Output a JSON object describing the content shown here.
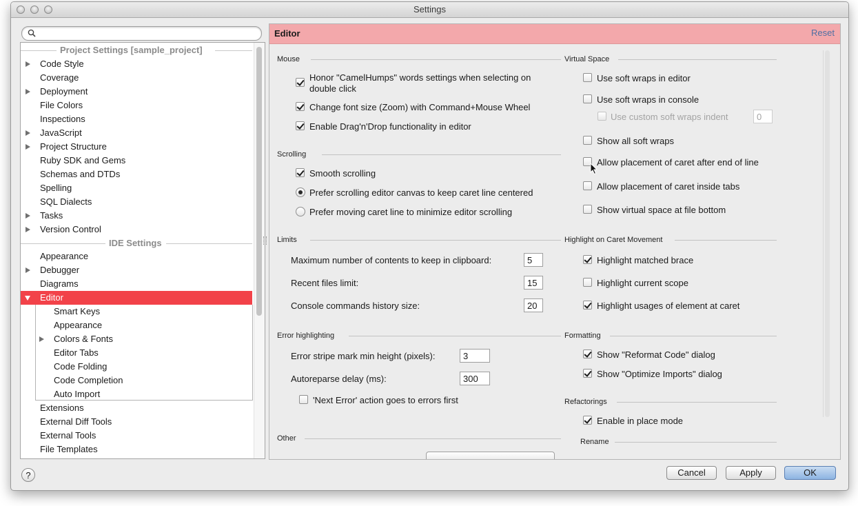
{
  "window": {
    "title": "Settings"
  },
  "search": {
    "placeholder": "",
    "value": ""
  },
  "tree": {
    "project_group": "Project Settings [sample_project]",
    "project_items": [
      "Code Style",
      "Coverage",
      "Deployment",
      "File Colors",
      "Inspections",
      "JavaScript",
      "Project Structure",
      "Ruby SDK and Gems",
      "Schemas and DTDs",
      "Spelling",
      "SQL Dialects",
      "Tasks",
      "Version Control"
    ],
    "ide_group": "IDE Settings",
    "ide_items": [
      "Appearance",
      "Debugger",
      "Diagrams",
      "Editor"
    ],
    "editor_children": [
      "Smart Keys",
      "Appearance",
      "Colors & Fonts",
      "Editor Tabs",
      "Code Folding",
      "Code Completion",
      "Auto Import"
    ],
    "after_items": [
      "Extensions",
      "External Diff Tools",
      "External Tools",
      "File Templates"
    ],
    "selected": "Editor"
  },
  "editor": {
    "title": "Editor",
    "reset_label": "Reset",
    "mouse": {
      "title": "Mouse",
      "camelhumps_line1": "Honor \"CamelHumps\" words settings when selecting on",
      "camelhumps_line2": "double click",
      "change_font": "Change font size (Zoom) with Command+Mouse Wheel",
      "drag_drop": "Enable Drag'n'Drop functionality in editor"
    },
    "scrolling": {
      "title": "Scrolling",
      "smooth": "Smooth scrolling",
      "prefer_canvas": "Prefer scrolling editor canvas to keep caret line centered",
      "prefer_caret": "Prefer moving caret line to minimize editor scrolling"
    },
    "limits": {
      "title": "Limits",
      "clipboard_label": "Maximum number of contents to keep in clipboard:",
      "clipboard_value": "5",
      "recent_label": "Recent files limit:",
      "recent_value": "15",
      "console_label": "Console commands history size:",
      "console_value": "20"
    },
    "error": {
      "title": "Error highlighting",
      "stripe_label": "Error stripe mark min height (pixels):",
      "stripe_value": "3",
      "autoreparse_label": "Autoreparse delay (ms):",
      "autoreparse_value": "300",
      "next_error": "'Next Error' action goes to errors first"
    },
    "other": {
      "title": "Other"
    },
    "virtual": {
      "title": "Virtual Space",
      "soft_wraps_editor": "Use soft wraps in editor",
      "soft_wraps_console": "Use soft wraps in console",
      "custom_indent": "Use custom soft wraps indent",
      "custom_indent_value": "0",
      "show_all": "Show all soft wraps",
      "caret_after_eol": "Allow placement of caret after end of line",
      "caret_inside_tabs": "Allow placement of caret inside tabs",
      "virtual_bottom": "Show virtual space at file bottom"
    },
    "highlight": {
      "title": "Highlight on Caret Movement",
      "matched_brace": "Highlight matched brace",
      "current_scope": "Highlight current scope",
      "usages": "Highlight usages of element at caret"
    },
    "formatting": {
      "title": "Formatting",
      "reformat": "Show \"Reformat Code\" dialog",
      "optimize": "Show \"Optimize Imports\" dialog"
    },
    "refactorings": {
      "title": "Refactorings",
      "in_place": "Enable in place mode",
      "rename": "Rename"
    }
  },
  "buttons": {
    "help": "?",
    "cancel": "Cancel",
    "apply": "Apply",
    "ok": "OK"
  },
  "colors": {
    "selection": "#f24249",
    "header": "#f3a8ab",
    "link": "#4f6fa3"
  }
}
